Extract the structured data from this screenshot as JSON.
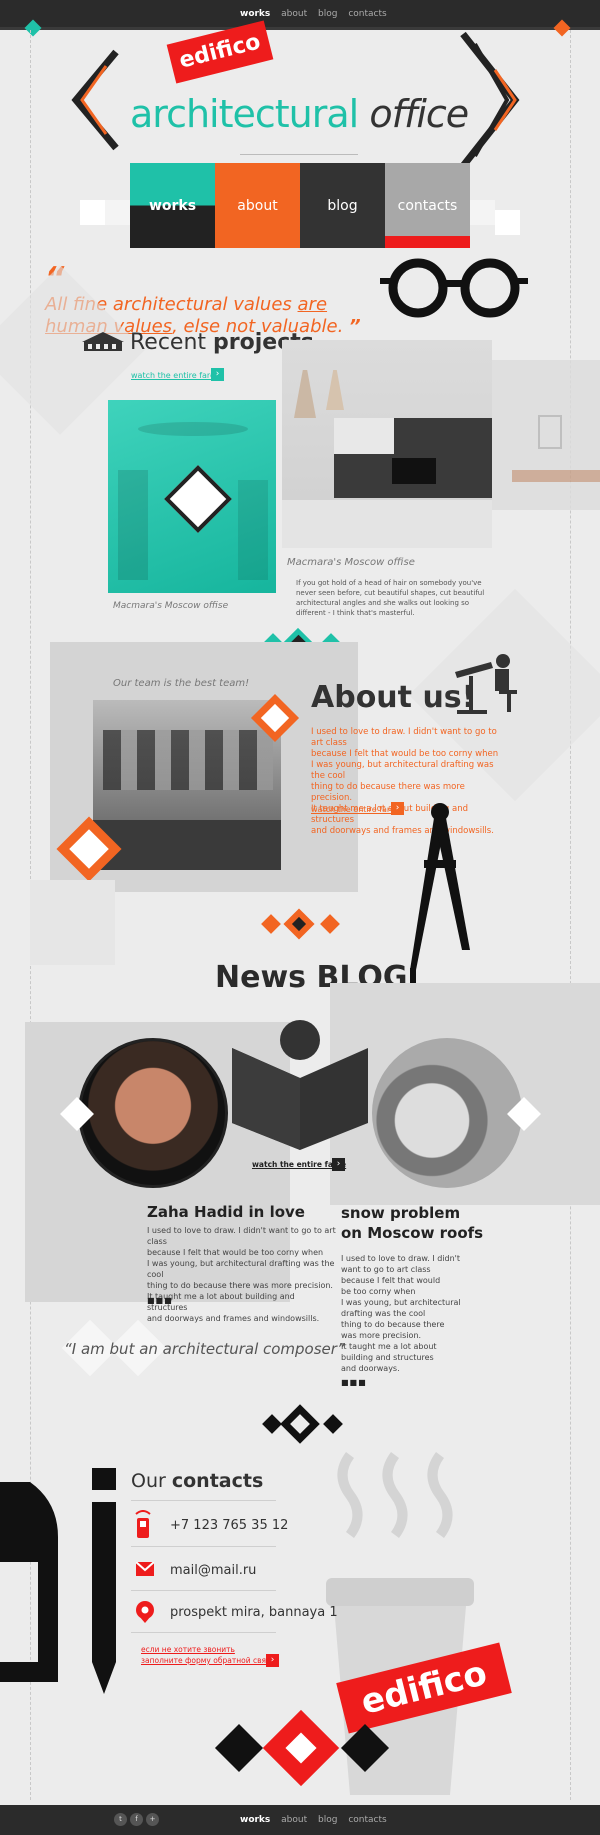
{
  "top_nav": [
    "works",
    "about",
    "blog",
    "contacts"
  ],
  "brand": {
    "badge": "edifico",
    "title_1": "architectural",
    "title_2": "office"
  },
  "menu": [
    {
      "label": "works",
      "bg": "#1fc1a8",
      "bottom": "#222222"
    },
    {
      "label": "about",
      "bg": "#f26522",
      "bottom": "#f26522"
    },
    {
      "label": "blog",
      "bg": "#333333",
      "bottom": "#333333"
    },
    {
      "label": "contacts",
      "bg": "#a8a8a8",
      "bottom": "#ee1c1c"
    }
  ],
  "quote": {
    "open": "“",
    "part1": "All fine architectural values ",
    "part2": "are human values",
    "part3": ", else not valuable.",
    "close": "”"
  },
  "projects": {
    "title_light": "Recent ",
    "title_bold": "projects",
    "link": "watch the entire farce",
    "caption_left": "Macmara's Moscow offise",
    "caption_right": "Macmara's Moscow offise",
    "description": "If you got hold of a head of hair on somebody you've never seen before, cut beautiful shapes, cut beautiful architectural angles and she walks out looking so different - I think that's masterful."
  },
  "about": {
    "caption": "Our team is the best team!",
    "title": "About us!",
    "text": [
      "I used to love to draw. I didn't want to go to art class",
      "because I felt that would be too corny when",
      "I was young, but architectural drafting was the cool",
      "thing to do because there was more precision.",
      "It taught me a lot about building and structures",
      "and doorways and frames and windowsills."
    ],
    "link": "watch the entire farce"
  },
  "blog": {
    "title": "News BLOG",
    "link": "watch the entire farce",
    "post1": {
      "title": "Zaha Hadid in love",
      "text": [
        "I used to love to draw. I didn't want to go to art class",
        "because I felt that would be too corny when",
        "I was young, but architectural drafting was the cool",
        "thing to do because there was more precision.",
        "It taught me a lot about building and structures",
        "and doorways and frames and windowsills."
      ],
      "more": "■■■"
    },
    "post2": {
      "title_1": "snow problem",
      "title_2": "on Moscow roofs",
      "text": [
        "I used to love to draw. I didn't",
        "want to go to art class",
        "because I felt that would",
        "be too corny when",
        "I was young, but architectural",
        "drafting was the cool",
        "thing to do because there",
        "was more precision.",
        "It taught me a lot about",
        "building and structures",
        "and doorways."
      ],
      "more": "■■■"
    },
    "quote": "“I am but an architectural composer”"
  },
  "contacts": {
    "title_light": "Our ",
    "title_bold": "contacts",
    "phone": "+7 123 765 35 12",
    "email": "mail@mail.ru",
    "address": "prospekt mira, bannaya 1",
    "callback_1": "если не хотите звонить",
    "callback_2": "заполните форму обратной связи"
  },
  "footer": {
    "badge": "edifico",
    "nav": [
      "works",
      "about",
      "blog",
      "contacts"
    ]
  },
  "colors": {
    "teal": "#1fc1a8",
    "orange": "#f26522",
    "red": "#ee1c1c",
    "dark": "#2b2b2b"
  }
}
